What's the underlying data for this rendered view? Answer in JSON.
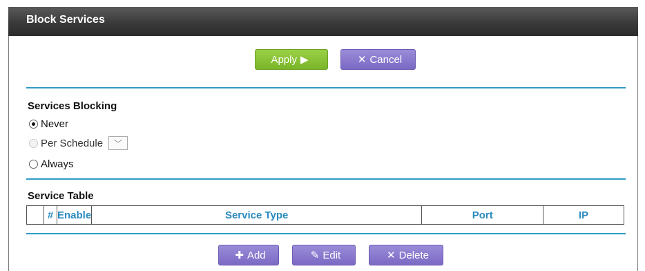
{
  "page": {
    "title": "Block Services"
  },
  "actions": {
    "apply_label": "Apply",
    "cancel_label": "Cancel"
  },
  "blocking": {
    "heading": "Services Blocking",
    "options": [
      {
        "label": "Never",
        "selected": true,
        "enabled": true
      },
      {
        "label": "Per Schedule",
        "selected": false,
        "enabled": false
      },
      {
        "label": "Always",
        "selected": false,
        "enabled": true
      }
    ]
  },
  "service_table": {
    "heading": "Service Table",
    "columns": [
      "",
      "#",
      "Enable",
      "Service Type",
      "Port",
      "IP"
    ]
  },
  "table_actions": {
    "add_label": "Add",
    "edit_label": "Edit",
    "delete_label": "Delete"
  },
  "colors": {
    "accent_blue": "#2f9bc4",
    "apply_green": "#8cc63e",
    "button_purple": "#8a7bd0"
  }
}
